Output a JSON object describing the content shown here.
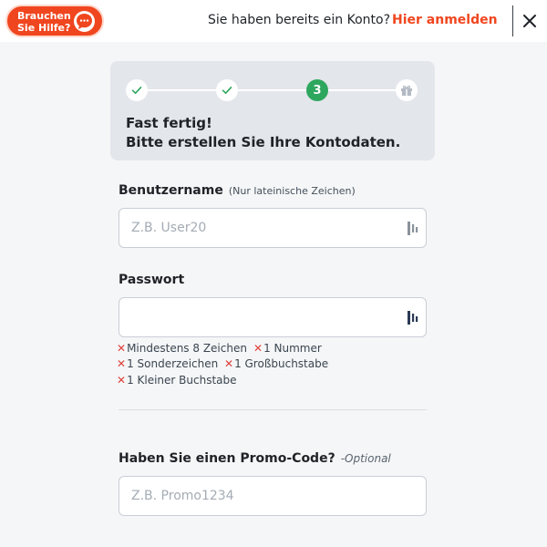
{
  "header": {
    "help_line1": "Brauchen",
    "help_line2": "Sie Hilfe?",
    "have_account": "Sie haben bereits ein Konto?",
    "login_link": "Hier anmelden"
  },
  "progress": {
    "active_step": "3",
    "title_line1": "Fast fertig!",
    "title_line2": "Bitte erstellen Sie Ihre Kontodaten."
  },
  "username": {
    "label": "Benutzername",
    "hint": "(Nur lateinische Zeichen)",
    "placeholder": "Z.B. User20",
    "value": ""
  },
  "password": {
    "label": "Passwort",
    "value": "",
    "requirements": [
      "Mindestens 8 Zeichen",
      "1 Nummer",
      "1 Sonderzeichen",
      "1 Großbuchstabe",
      "1 Kleiner Buchstabe"
    ]
  },
  "promo": {
    "label": "Haben Sie einen Promo-Code?",
    "optional": "-Optional",
    "placeholder": "Z.B. Promo1234",
    "value": ""
  },
  "colors": {
    "accent": "#f0461f",
    "success": "#2da75e",
    "error": "#e0403a"
  }
}
